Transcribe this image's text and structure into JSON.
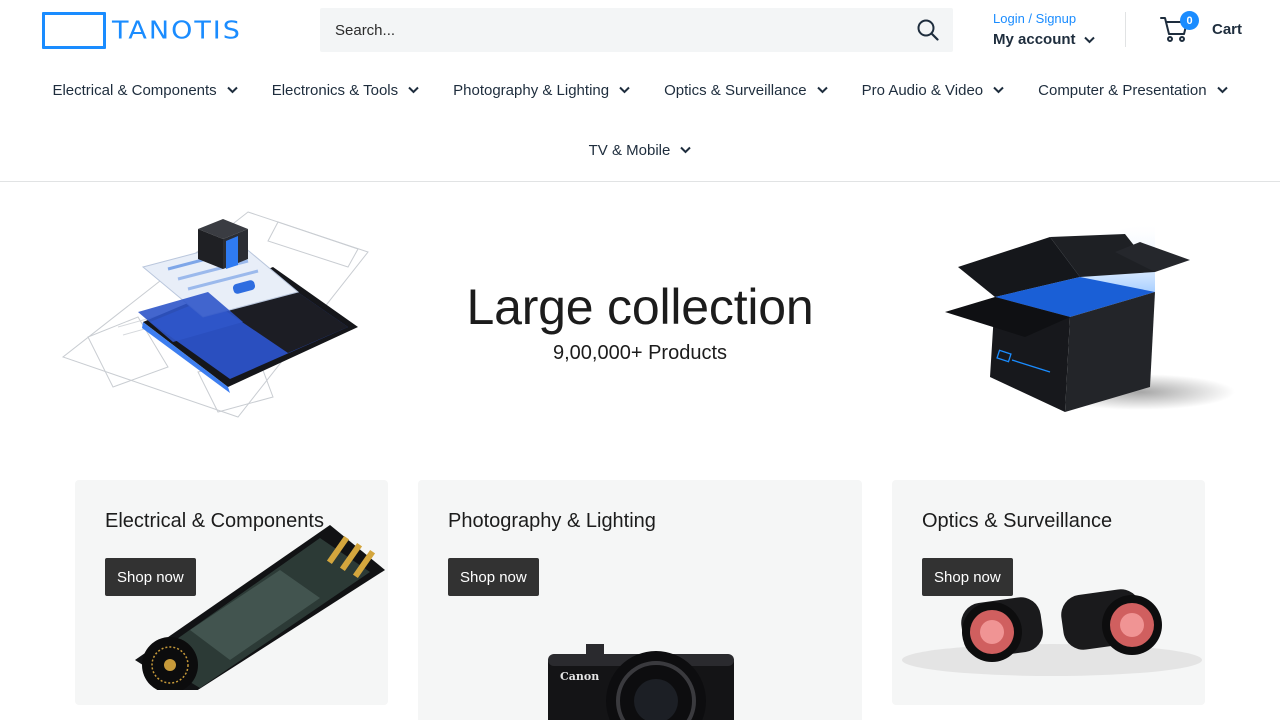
{
  "brand": {
    "name": "TANOTIS",
    "color": "#1a8cff"
  },
  "search": {
    "placeholder": "Search..."
  },
  "account": {
    "login_label": "Login / Signup",
    "my_account_label": "My account"
  },
  "cart": {
    "count": "0",
    "label": "Cart"
  },
  "nav": {
    "items": [
      {
        "label": "Electrical & Components"
      },
      {
        "label": "Electronics & Tools"
      },
      {
        "label": "Photography & Lighting"
      },
      {
        "label": "Optics & Surveillance"
      },
      {
        "label": "Pro Audio & Video"
      },
      {
        "label": "Computer & Presentation"
      },
      {
        "label": "TV & Mobile"
      }
    ]
  },
  "hero": {
    "title": "Large collection",
    "subtitle": "9,00,000+ Products"
  },
  "categories": [
    {
      "title": "Electrical & Components",
      "button": "Shop now"
    },
    {
      "title": "Photography & Lighting",
      "button": "Shop now"
    },
    {
      "title": "Optics & Surveillance",
      "button": "Shop now"
    }
  ],
  "icons": {
    "search": "search-icon",
    "chevron": "chevron-down-icon",
    "cart": "cart-icon"
  }
}
